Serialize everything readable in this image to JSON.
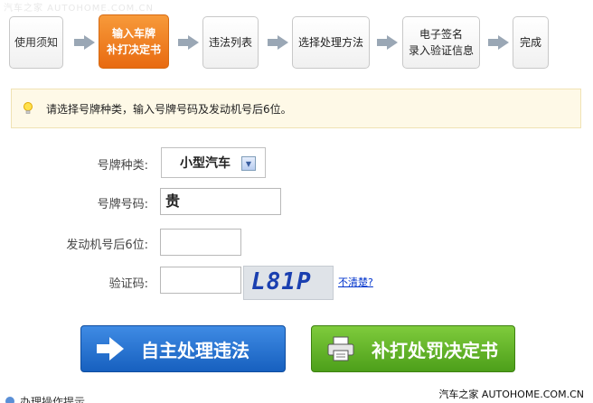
{
  "watermark_top": "汽车之家 AUTOHOME.COM.CN",
  "steps": [
    {
      "label": "使用须知"
    },
    {
      "label": "输入车牌\n补打决定书"
    },
    {
      "label": "违法列表"
    },
    {
      "label": "选择处理方法"
    },
    {
      "label": "电子签名\n录入验证信息"
    },
    {
      "label": "完成"
    }
  ],
  "notice": {
    "icon": "lightbulb-icon",
    "text": "请选择号牌种类，输入号牌号码及发动机号后6位。"
  },
  "form": {
    "plate_type_label": "号牌种类:",
    "plate_type_value": "小型汽车",
    "plate_number_label": "号牌号码:",
    "plate_number_value": "贵",
    "engine_label": "发动机号后6位:",
    "engine_value": "",
    "captcha_label": "验证码:",
    "captcha_value": "",
    "captcha_image_text": "L81P",
    "unclear_link": "不清楚?"
  },
  "buttons": {
    "self_process": "自主处理违法",
    "reprint": "补打处罚决定书"
  },
  "bottom_hint": "办理操作提示",
  "watermark": "汽车之家 AUTOHOME.COM.CN",
  "colors": {
    "active_step": "#f07f1f",
    "blue_button": "#1f6fd0",
    "green_button": "#62b52a",
    "link": "#0033cc"
  }
}
